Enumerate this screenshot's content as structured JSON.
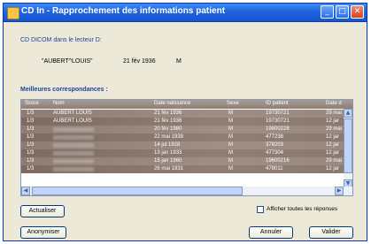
{
  "window": {
    "title": "CD In - Rapprochement des informations patient"
  },
  "source_label": "CD DICOM dans le lecteur D:",
  "patient": {
    "name": "\"AUBERT^LOUIS\"",
    "birth_date": "21 fév 1936",
    "sex": "M"
  },
  "matches_label": "Meilleures correspondances :",
  "table": {
    "columns": [
      "Score",
      "Nom",
      "Date naissance",
      "Sexe",
      "ID patient",
      "Date d"
    ],
    "rows": [
      [
        "1/3",
        "AUBERT LOUIS",
        "21 fév 1936",
        "M",
        "19730721",
        "29 mai"
      ],
      [
        "1/3",
        "AUBERT LOUIS",
        "21 fév 1936",
        "M",
        "19730721",
        "12 jar"
      ],
      [
        "1/3",
        "",
        "20 fév 1980",
        "M",
        "19800228",
        "29 mai"
      ],
      [
        "1/3",
        "",
        "22 mai 1939",
        "M",
        "477238",
        "12 jar"
      ],
      [
        "1/3",
        "",
        "14 jul 1928",
        "M",
        "378203",
        "12 jar"
      ],
      [
        "1/3",
        "",
        "13 jan 1933",
        "M",
        "477304",
        "12 jar"
      ],
      [
        "1/3",
        "",
        "15 jan 1960",
        "M",
        "19600216",
        "29 mai"
      ],
      [
        "1/3",
        "",
        "26 mai 1931",
        "M",
        "478011",
        "12 jar"
      ]
    ]
  },
  "buttons": {
    "refresh": "Actualiser",
    "anonymize": "Anonymiser",
    "cancel": "Annuler",
    "validate": "Valider"
  },
  "show_all_label": "Afficher toutes les réponses"
}
